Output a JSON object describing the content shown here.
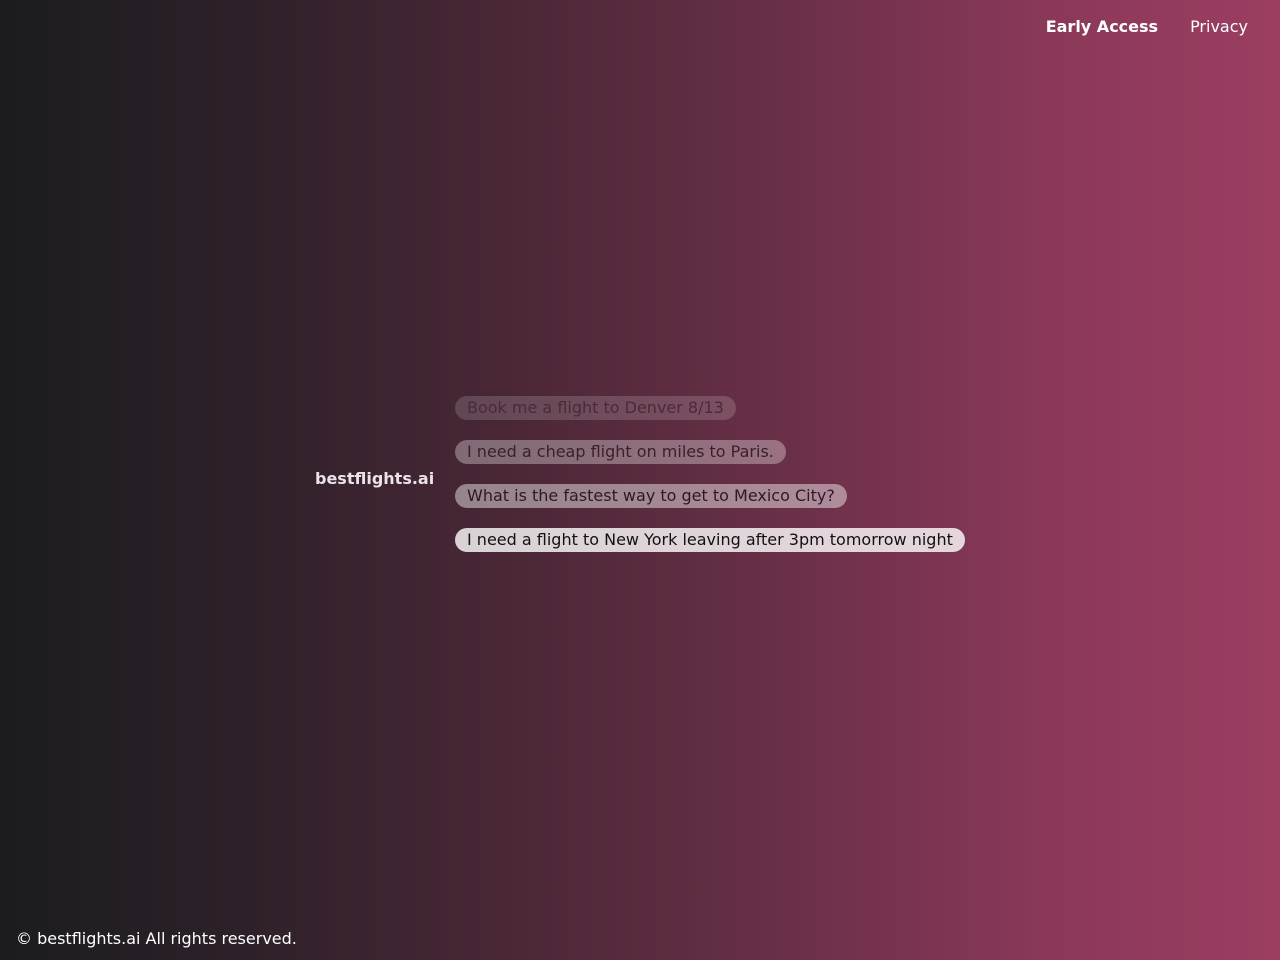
{
  "nav": {
    "early_access": "Early Access",
    "privacy": "Privacy"
  },
  "brand": {
    "name": "bestflights.ai"
  },
  "suggestions": [
    {
      "text": "Book me a flight to Denver 8/13"
    },
    {
      "text": "I need a cheap flight on miles to Paris."
    },
    {
      "text": "What is the fastest way to get to Mexico City?"
    },
    {
      "text": "I need a flight to New York leaving after 3pm tomorrow night"
    }
  ],
  "footer": {
    "copyright": "© bestflights.ai All rights reserved."
  },
  "colors": {
    "gradient_start": "#1b1c20",
    "gradient_end": "#9b3e62"
  }
}
